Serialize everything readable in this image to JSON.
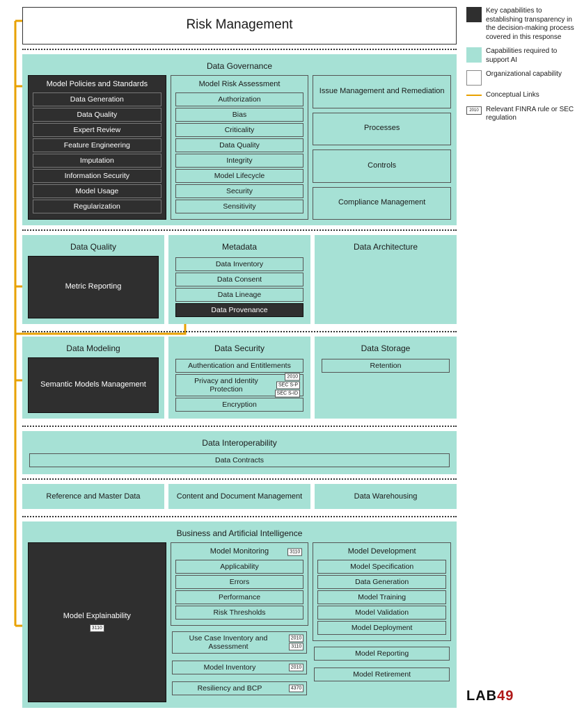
{
  "title": "Risk Management",
  "legend": {
    "dark": "Key capabilities to establishing transparency in the decision-making process covered in this response",
    "teal": "Capabilities required to support AI",
    "white": "Organizational capability",
    "links": "Conceptual Links",
    "tag_sample": "2010",
    "tag_desc": "Relevant FINRA rule or SEC regulation"
  },
  "governance": {
    "title": "Data Governance",
    "policies": {
      "title": "Model Policies and Standards",
      "items": [
        "Data Generation",
        "Data Quality",
        "Expert Review",
        "Feature Engineering",
        "Imputation",
        "Information Security",
        "Model Usage",
        "Regularization"
      ]
    },
    "risk": {
      "title": "Model Risk Assessment",
      "items": [
        "Authorization",
        "Bias",
        "Criticality",
        "Data Quality",
        "Integrity",
        "Model Lifecycle",
        "Security",
        "Sensitivity"
      ]
    },
    "imr": {
      "title": "Issue Management and Remediation",
      "items": [
        "Processes",
        "Controls",
        "Compliance Management"
      ]
    }
  },
  "dq_row": {
    "dq": {
      "title": "Data Quality",
      "metric": "Metric Reporting"
    },
    "meta": {
      "title": "Metadata",
      "items": [
        "Data Inventory",
        "Data Consent",
        "Data Lineage"
      ],
      "dark": "Data Provenance"
    },
    "arch": {
      "title": "Data Architecture"
    }
  },
  "dm_row": {
    "dm": {
      "title": "Data Modeling",
      "dark": "Semantic Models Management"
    },
    "sec": {
      "title": "Data Security",
      "auth": "Authentication and Entitlements",
      "priv": "Privacy and Identity Protection",
      "priv_tags": [
        "2010",
        "SEC S-P",
        "SEC S-ID"
      ],
      "enc": "Encryption"
    },
    "storage": {
      "title": "Data Storage",
      "ret": "Retention"
    }
  },
  "interop": {
    "title": "Data Interoperability",
    "item": "Data Contracts"
  },
  "row5": {
    "a": "Reference and Master Data",
    "b": "Content and Document Management",
    "c": "Data Warehousing"
  },
  "bai": {
    "title": "Business and Artificial Intelligence",
    "explain": {
      "title": "Model Explainability",
      "tag": "3110"
    },
    "monitor": {
      "title": "Model Monitoring",
      "title_tag": "3110",
      "items": [
        "Applicability",
        "Errors",
        "Performance",
        "Risk Thresholds"
      ]
    },
    "use_inv": {
      "title": "Use Case Inventory and Assessment",
      "tags": [
        "2010",
        "3110"
      ]
    },
    "model_inv": {
      "title": "Model Inventory",
      "tag": "2010"
    },
    "resil": {
      "title": "Resiliency and BCP",
      "tag": "4370"
    },
    "dev": {
      "title": "Model Development",
      "items": [
        "Model Specification",
        "Data Generation",
        "Model Training",
        "Model Validation",
        "Model Deployment"
      ]
    },
    "report": "Model Reporting",
    "retire": "Model Retirement"
  },
  "logo": {
    "a": "LAB",
    "b": "49"
  }
}
